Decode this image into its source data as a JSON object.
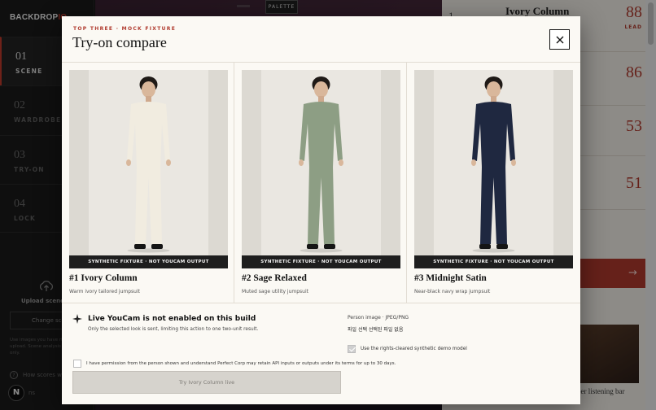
{
  "app": {
    "brand_main": "BACKDROP",
    "brand_accent": "IQ",
    "steps": [
      {
        "num": "01",
        "label": "SCENE",
        "active": true
      },
      {
        "num": "02",
        "label": "WARDROBE",
        "active": false
      },
      {
        "num": "03",
        "label": "TRY-ON",
        "active": false
      },
      {
        "num": "04",
        "label": "LOCK",
        "active": false
      }
    ],
    "upload_label": "Upload scene i",
    "change_label": "Change scen",
    "side_note": "Use images you have ri upload. Scene analysis only.",
    "help_label": "How scores work",
    "avatar_letter": "N",
    "avatar_text": "ns",
    "palette_label": "PALETTE",
    "ranked": [
      {
        "rank": "1",
        "title": "Ivory Column",
        "score": "88",
        "tag": "LEAD"
      },
      {
        "rank": "",
        "title": "",
        "score": "86",
        "tag": ""
      },
      {
        "rank": "",
        "title": "",
        "score": "53",
        "tag": ""
      },
      {
        "rank": "",
        "title": "",
        "score": "51",
        "tag": ""
      }
    ],
    "caption": "ber listening bar"
  },
  "modal": {
    "eyebrow": "TOP THREE · MOCK FIXTURE",
    "title": "Try-on compare",
    "close_label": "Close",
    "cards": [
      {
        "title": "#1 Ivory Column",
        "subtitle": "Warm ivory tailored jumpsuit",
        "badge": "SYNTHETIC FIXTURE · NOT YOUCAM OUTPUT",
        "color": "#f1ece0"
      },
      {
        "title": "#2 Sage Relaxed",
        "subtitle": "Muted sage utility jumpsuit",
        "badge": "SYNTHETIC FIXTURE · NOT YOUCAM OUTPUT",
        "color": "#8d9e84"
      },
      {
        "title": "#3 Midnight Satin",
        "subtitle": "Near-black navy wrap jumpsuit",
        "badge": "SYNTHETIC FIXTURE · NOT YOUCAM OUTPUT",
        "color": "#1f2840"
      }
    ],
    "notice_title": "Live YouCam is not enabled on this build",
    "notice_sub": "Only the selected look is sent, limiting this action to one two-unit result.",
    "person_label": "Person image · JPEG/PNG",
    "person_file": "파일 선택  선택된 파일 없음",
    "demo_label": "Use the rights-cleared synthetic demo model",
    "demo_checked": true,
    "permission_label": "I have permission from the person shown and understand Perfect Corp may retain API inputs or outputs under its terms for up to 30 days.",
    "permission_checked": false,
    "try_label": "Try Ivory Column live"
  }
}
